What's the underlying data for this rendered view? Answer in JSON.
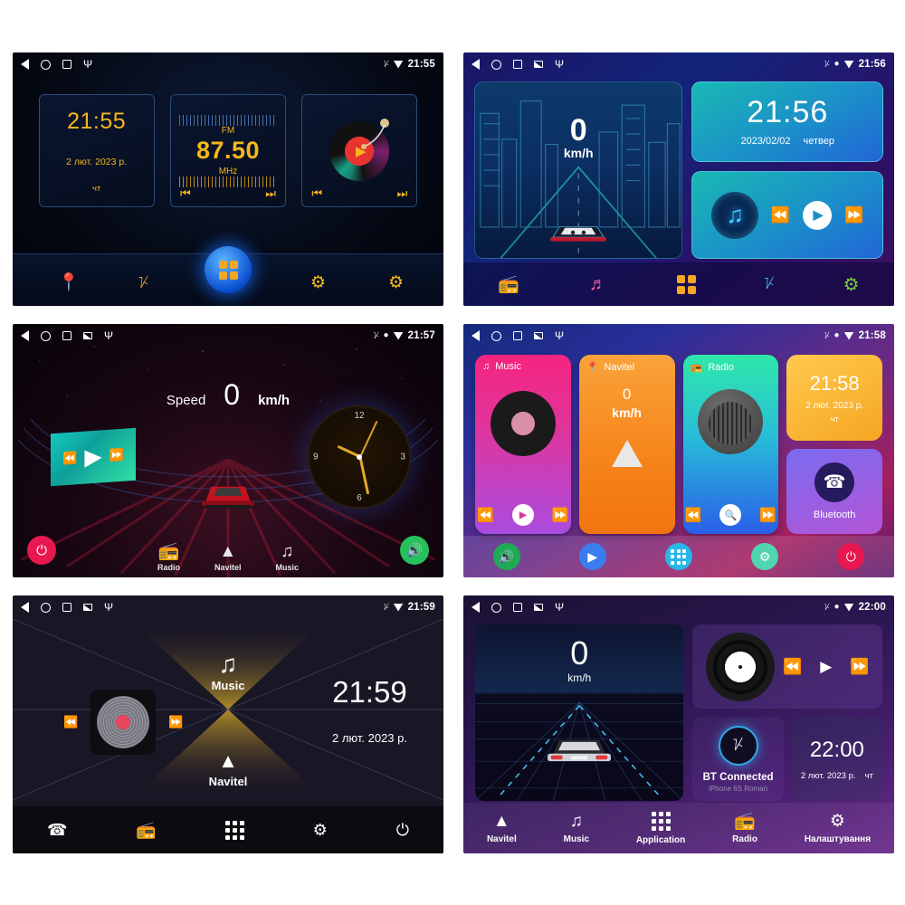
{
  "panels": [
    {
      "id": "panel-1-classic-blue",
      "statusbar": {
        "icons": [
          "back-icon",
          "home-icon",
          "recent-apps-icon",
          "usb-icon"
        ],
        "tray": [
          "bluetooth-icon",
          "wifi-icon"
        ],
        "time": "21:55"
      },
      "clock_card": {
        "time": "21:55",
        "date": "2 лют. 2023 р.",
        "weekday": "чт"
      },
      "radio_card": {
        "band": "FM",
        "frequency": "87.50",
        "unit": "MHz",
        "prev": "prev-icon",
        "next": "next-icon"
      },
      "music_card": {
        "play": "play-icon",
        "prev": "prev-icon",
        "next": "next-icon"
      },
      "dock": [
        "gps-pin-icon",
        "bluetooth-icon",
        "apps-grid-icon",
        "steering-wheel-icon",
        "settings-gear-icon"
      ]
    },
    {
      "id": "panel-2-neon-city",
      "statusbar": {
        "icons": [
          "back-icon",
          "home-icon",
          "recent-apps-icon",
          "screenshot-icon",
          "usb-icon"
        ],
        "tray": [
          "bluetooth-icon",
          "gps-icon",
          "wifi-icon"
        ],
        "time": "21:56"
      },
      "speed": {
        "value": "0",
        "unit": "km/h"
      },
      "clock_card": {
        "time": "21:56",
        "date": "2023/02/02",
        "weekday": "четвер"
      },
      "music_card": {
        "icon": "music-note-icon",
        "prev": "prev-icon",
        "play": "play-icon",
        "next": "next-icon"
      },
      "dock": [
        "radio-icon",
        "music-note-icon",
        "apps-grid-icon",
        "bluetooth-icon",
        "settings-gear-icon"
      ]
    },
    {
      "id": "panel-3-dark-speed",
      "statusbar": {
        "icons": [
          "back-icon",
          "home-icon",
          "recent-apps-icon",
          "screenshot-icon",
          "usb-icon"
        ],
        "tray": [
          "bluetooth-icon",
          "gps-icon",
          "wifi-icon"
        ],
        "time": "21:57"
      },
      "speed": {
        "label": "Speed",
        "value": "0",
        "unit": "km/h"
      },
      "analog_clock": {
        "n12": "12",
        "n3": "3",
        "n6": "6",
        "n9": "9"
      },
      "media_icon": {
        "prev": "prev-icon",
        "play": "play-icon",
        "next": "next-icon"
      },
      "left_button": "power-icon",
      "right_button": "volume-icon",
      "apps": [
        {
          "icon": "radio-icon",
          "label": "Radio"
        },
        {
          "icon": "navigation-arrow-icon",
          "label": "Navitel"
        },
        {
          "icon": "music-note-icon",
          "label": "Music"
        }
      ]
    },
    {
      "id": "panel-4-color-tiles",
      "statusbar": {
        "icons": [
          "back-icon",
          "home-icon",
          "recent-apps-icon",
          "screenshot-icon",
          "usb-icon"
        ],
        "tray": [
          "bluetooth-icon",
          "gps-icon",
          "wifi-icon"
        ],
        "time": "21:58"
      },
      "tiles": [
        {
          "name": "Music",
          "icon": "music-note-icon",
          "controls": [
            "prev-icon",
            "play-icon",
            "next-icon"
          ]
        },
        {
          "name": "Navitel",
          "icon": "gps-pin-icon",
          "speed": "0",
          "unit": "km/h"
        },
        {
          "name": "Radio",
          "icon": "radio-icon",
          "controls": [
            "prev-icon",
            "search-icon",
            "next-icon"
          ]
        }
      ],
      "clock_tile": {
        "time": "21:58",
        "date": "2 лют. 2023 р.",
        "weekday": "чт"
      },
      "bluetooth_tile": {
        "icon": "phone-icon",
        "label": "Bluetooth"
      },
      "dock": [
        "volume-icon",
        "play-icon",
        "apps-grid-icon",
        "settings-gear-icon",
        "power-icon"
      ]
    },
    {
      "id": "panel-5-xcross",
      "statusbar": {
        "icons": [
          "back-icon",
          "home-icon",
          "recent-apps-icon",
          "screenshot-icon",
          "usb-icon"
        ],
        "tray": [
          "bluetooth-icon",
          "wifi-icon"
        ],
        "time": "21:59"
      },
      "player": {
        "icon": "turntable-icon",
        "prev": "prev-icon",
        "next": "next-icon"
      },
      "music": {
        "icon": "music-note-icon",
        "label": "Music"
      },
      "navitel": {
        "icon": "navigation-arrow-icon",
        "label": "Navitel"
      },
      "clock": {
        "time": "21:59",
        "date": "2 лют. 2023 р."
      },
      "dock": [
        "phone-call-icon",
        "radio-icon",
        "apps-grid-icon",
        "settings-gear-icon",
        "power-icon"
      ]
    },
    {
      "id": "panel-6-purple-road",
      "statusbar": {
        "icons": [
          "back-icon",
          "home-icon",
          "recent-apps-icon",
          "screenshot-icon",
          "usb-icon"
        ],
        "tray": [
          "bluetooth-icon",
          "gps-icon",
          "wifi-icon"
        ],
        "time": "22:00"
      },
      "speed": {
        "value": "0",
        "unit": "km/h"
      },
      "vinyl_card": {
        "icon": "vinyl-record-icon",
        "controls": [
          "prev-icon",
          "play-icon",
          "next-icon"
        ]
      },
      "bluetooth_card": {
        "icon": "bluetooth-icon",
        "title": "BT Connected",
        "subtitle": "iPhone 6S Roman"
      },
      "clock_card": {
        "time": "22:00",
        "date": "2 лют. 2023 р.",
        "weekday": "чт"
      },
      "dock": [
        {
          "icon": "navigation-arrow-icon",
          "label": "Navitel"
        },
        {
          "icon": "music-note-icon",
          "label": "Music"
        },
        {
          "icon": "apps-grid-icon",
          "label": "Application"
        },
        {
          "icon": "radio-icon",
          "label": "Radio"
        },
        {
          "icon": "settings-gear-icon",
          "label": "Налаштування"
        }
      ]
    }
  ],
  "colors": {
    "amber": "#f5b81c",
    "neon_cyan": "#19b9b4",
    "pink": "#f6247f",
    "orange": "#f6861c",
    "green": "#25c25b",
    "red": "#e8174f",
    "bt_blue": "#2fa8e8"
  }
}
